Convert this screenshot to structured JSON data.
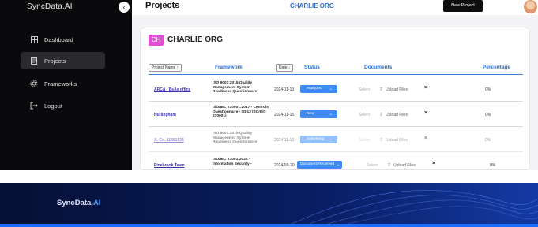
{
  "sidebar": {
    "brand": "SyncData.AI",
    "collapse_icon": "chevron-left",
    "items": [
      {
        "label": "Dashboard",
        "icon": "dashboard-icon"
      },
      {
        "label": "Projects",
        "icon": "document-icon",
        "active": true
      },
      {
        "label": "Frameworks",
        "icon": "gear-icon"
      },
      {
        "label": "Logout",
        "icon": "logout-icon"
      }
    ]
  },
  "header": {
    "title": "Projects",
    "org": "CHARLIE ORG",
    "new_project": "New Project"
  },
  "card": {
    "badge": "CH",
    "badge_color": "#e34fd3",
    "org_title": "CHARLIE ORG",
    "columns": {
      "project": "Project Name ↑",
      "framework": "Framework",
      "date": "Date ↓",
      "status": "Status",
      "documents": "Documents",
      "percentage": "Percentage"
    },
    "rows": [
      {
        "project": "ARCA - BsAs office",
        "framework": "ISO 9001:2015 Quality Management System - Readiness Questionnare",
        "date": "2024-11-13",
        "status": "Analyzed",
        "select": "Select",
        "upload": "Upload Files",
        "delete": "×",
        "percentage": "0%"
      },
      {
        "project": "Hurlingham",
        "framework": "ISO/IEC 270001:2017 - Centrols Questionnaire - (2013 ISO/IEC 270001)",
        "date": "2024-11-15",
        "status": "New",
        "select": "Select",
        "upload": "Upload Files",
        "delete": "×",
        "percentage": "0%"
      },
      {
        "project": "A. Co. 11591024",
        "framework": "ISO 9001:2015 Quality Management System Readiness Questionnare",
        "date": "2024-11-12",
        "status": "Answering",
        "select": "Select",
        "upload": "Upload Files",
        "delete": "×",
        "percentage": "0%"
      },
      {
        "project": "Pinebrook Team",
        "framework": "ISO/IEC 27001:2022 - Information Security -",
        "date": "2024-09-20",
        "status": "Document Received",
        "select": "Select",
        "upload": "Upload Files",
        "delete": "×",
        "percentage": "0%"
      }
    ]
  },
  "banner": {
    "logo_main": "SyncData.",
    "logo_accent": "AI"
  },
  "colors": {
    "accent": "#2a6fd6",
    "status_pill": "#3d8bf2",
    "sidebar_bg": "#0a0a0c",
    "banner_bg": "#061034"
  }
}
